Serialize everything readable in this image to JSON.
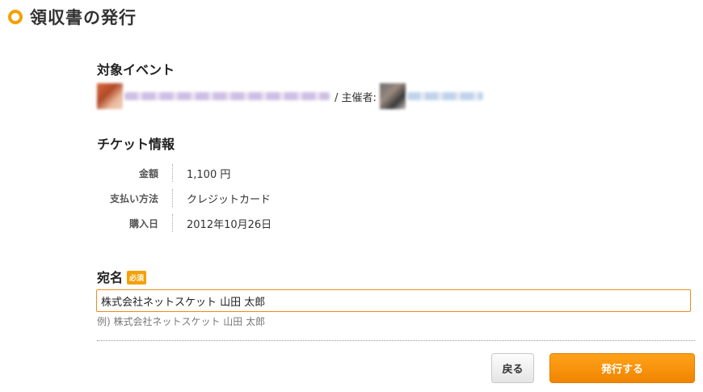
{
  "header": {
    "title": "領収書の発行",
    "icon": "circle-bullet-icon",
    "accent_color": "#f5a000"
  },
  "event": {
    "section_title": "対象イベント",
    "organizer_label": "/ 主催者:"
  },
  "ticket": {
    "section_title": "チケット情報",
    "rows": [
      {
        "label": "金額",
        "value": "1,100 円"
      },
      {
        "label": "支払い方法",
        "value": "クレジットカード"
      },
      {
        "label": "購入日",
        "value": "2012年10月26日"
      }
    ]
  },
  "recipient": {
    "label": "宛名",
    "required_badge": "必須",
    "value": "株式会社ネットスケット 山田 太郎",
    "example": "例) 株式会社ネットスケット 山田 太郎"
  },
  "actions": {
    "back_label": "戻る",
    "issue_label": "発行する",
    "issue_color": "#f08400"
  }
}
